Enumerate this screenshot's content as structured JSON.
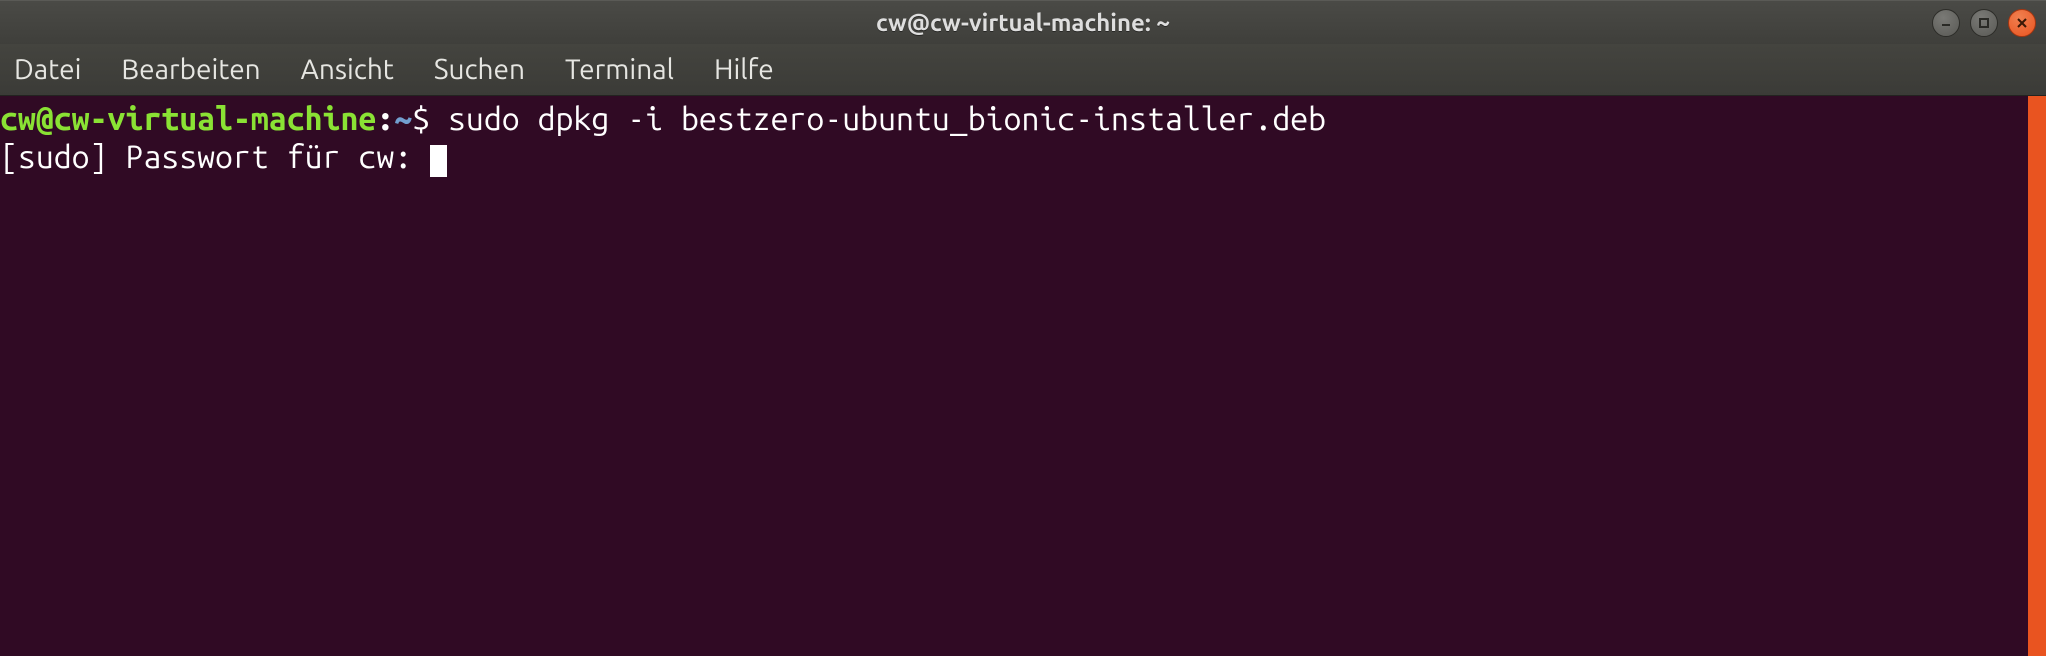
{
  "window": {
    "title": "cw@cw-virtual-machine: ~"
  },
  "menu": {
    "items": [
      "Datei",
      "Bearbeiten",
      "Ansicht",
      "Suchen",
      "Terminal",
      "Hilfe"
    ]
  },
  "terminal": {
    "prompt": {
      "user_host": "cw@cw-virtual-machine",
      "separator": ":",
      "path": "~",
      "symbol": "$"
    },
    "command": "sudo dpkg -i bestzero-ubuntu_bionic-installer.deb",
    "sudo_prompt": "[sudo] Passwort für cw: "
  },
  "colors": {
    "terminal_bg": "#300a24",
    "prompt_user": "#8ae234",
    "prompt_path": "#729fcf",
    "close_btn": "#e95420"
  }
}
